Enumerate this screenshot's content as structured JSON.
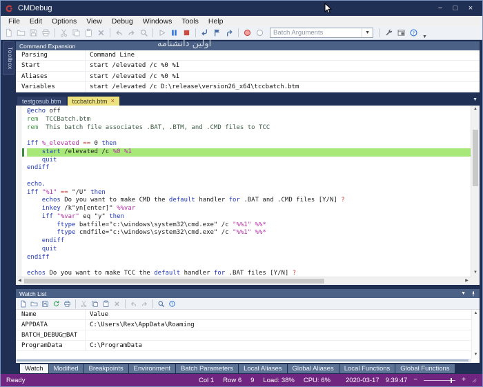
{
  "window": {
    "title": "CMDebug",
    "watermark": "اولین دانشنامه"
  },
  "titlebar": {
    "minimize": "−",
    "maximize": "□",
    "close": "×"
  },
  "menu": {
    "items": [
      "File",
      "Edit",
      "Options",
      "View",
      "Debug",
      "Windows",
      "Tools",
      "Help"
    ]
  },
  "toolbar": {
    "batch_arguments_placeholder": "Batch Arguments"
  },
  "toolbox": {
    "label": "Toolbox"
  },
  "command_expansion": {
    "title": "Command Expansion",
    "rows": [
      {
        "name": "Parsing",
        "value": "Command Line"
      },
      {
        "name": "Start",
        "value": "start /elevated /c %0 %1"
      },
      {
        "name": "Aliases",
        "value": "start /elevated /c %0 %1"
      },
      {
        "name": "Variables",
        "value": "start /elevated /c D:\\release\\version26_x64\\tccbatch.btm"
      }
    ]
  },
  "editor": {
    "tabs": [
      {
        "label": "testgosub.btm",
        "active": false
      },
      {
        "label": "tccbatch.btm",
        "active": true,
        "close": "×"
      }
    ],
    "lines": [
      {
        "s": [
          [
            "@echo",
            "k"
          ],
          [
            " off",
            "t"
          ]
        ]
      },
      {
        "s": [
          [
            "rem",
            "cg"
          ],
          [
            "  TCCBatch.btm",
            "ct"
          ]
        ]
      },
      {
        "s": [
          [
            "rem",
            "cg"
          ],
          [
            "  This batch file associates .BAT, .BTM, and .CMD files to TCC",
            "ct"
          ]
        ]
      },
      {
        "s": []
      },
      {
        "s": [
          [
            "iff",
            "k"
          ],
          [
            " ",
            "t"
          ],
          [
            "%_elevated",
            "v"
          ],
          [
            " ",
            "t"
          ],
          [
            "==",
            "o"
          ],
          [
            " 0 ",
            "t"
          ],
          [
            "then",
            "k"
          ]
        ]
      },
      {
        "hl": true,
        "s": [
          [
            "    ",
            "t"
          ],
          [
            "start",
            "k"
          ],
          [
            " /elevated /c ",
            "t"
          ],
          [
            "%0",
            "v"
          ],
          [
            " ",
            "t"
          ],
          [
            "%1",
            "v"
          ]
        ]
      },
      {
        "s": [
          [
            "    ",
            "t"
          ],
          [
            "quit",
            "k"
          ]
        ]
      },
      {
        "s": [
          [
            "endiff",
            "k"
          ]
        ]
      },
      {
        "s": []
      },
      {
        "s": [
          [
            "echo.",
            "k"
          ]
        ]
      },
      {
        "s": [
          [
            "iff",
            "k"
          ],
          [
            " ",
            "t"
          ],
          [
            "\"%1\"",
            "v"
          ],
          [
            " ",
            "t"
          ],
          [
            "==",
            "o"
          ],
          [
            " \"/U\" ",
            "t"
          ],
          [
            "then",
            "k"
          ]
        ]
      },
      {
        "s": [
          [
            "    ",
            "t"
          ],
          [
            "echos",
            "k"
          ],
          [
            " Do you want to make CMD the ",
            "t"
          ],
          [
            "default",
            "k"
          ],
          [
            " handler ",
            "t"
          ],
          [
            "for",
            "k"
          ],
          [
            " .BAT and .CMD files [Y/N] ",
            "t"
          ],
          [
            "?",
            "o"
          ]
        ]
      },
      {
        "s": [
          [
            "    ",
            "t"
          ],
          [
            "inkey",
            "k"
          ],
          [
            " /k\"yn[enter]\" ",
            "t"
          ],
          [
            "%%var",
            "v"
          ]
        ]
      },
      {
        "s": [
          [
            "    ",
            "t"
          ],
          [
            "iff",
            "k"
          ],
          [
            " ",
            "t"
          ],
          [
            "\"%var\"",
            "v"
          ],
          [
            " eq \"y\" ",
            "t"
          ],
          [
            "then",
            "k"
          ]
        ]
      },
      {
        "s": [
          [
            "        ",
            "t"
          ],
          [
            "ftype",
            "k"
          ],
          [
            " batfile=\"c:\\windows\\system32\\cmd.exe\" /c ",
            "t"
          ],
          [
            "\"%%1\"",
            "v"
          ],
          [
            " ",
            "t"
          ],
          [
            "%%*",
            "v"
          ]
        ]
      },
      {
        "s": [
          [
            "        ",
            "t"
          ],
          [
            "ftype",
            "k"
          ],
          [
            " cmdfile=\"c:\\windows\\system32\\cmd.exe\" /c ",
            "t"
          ],
          [
            "\"%%1\"",
            "v"
          ],
          [
            " ",
            "t"
          ],
          [
            "%%*",
            "v"
          ]
        ]
      },
      {
        "s": [
          [
            "    ",
            "t"
          ],
          [
            "endiff",
            "k"
          ]
        ]
      },
      {
        "s": [
          [
            "    ",
            "t"
          ],
          [
            "quit",
            "k"
          ]
        ]
      },
      {
        "s": [
          [
            "endiff",
            "k"
          ]
        ]
      },
      {
        "s": []
      },
      {
        "s": [
          [
            "echos",
            "k"
          ],
          [
            " Do you want to make TCC the ",
            "t"
          ],
          [
            "default",
            "k"
          ],
          [
            " handler ",
            "t"
          ],
          [
            "for",
            "k"
          ],
          [
            " .BAT files [Y/N] ",
            "t"
          ],
          [
            "?",
            "o"
          ]
        ]
      }
    ]
  },
  "watch": {
    "title": "Watch List",
    "columns": [
      "Name",
      "Value"
    ],
    "rows": [
      {
        "name": "APPDATA",
        "value": "C:\\Users\\Rex\\AppData\\Roaming"
      },
      {
        "name": "BATCH_DEBUG□BAT",
        "value": ""
      },
      {
        "name": "ProgramData",
        "value": "C:\\ProgramData"
      }
    ],
    "tabs": [
      "Watch",
      "Modified",
      "Breakpoints",
      "Environment",
      "Batch Parameters",
      "Local Aliases",
      "Global Aliases",
      "Local Functions",
      "Global Functions"
    ],
    "active_tab": "Watch"
  },
  "status": {
    "ready": "Ready",
    "col": "Col 1",
    "row": "Row 6",
    "count": "9",
    "load": "Load: 38%",
    "cpu": "CPU: 6%",
    "date": "2020-03-17",
    "time": "9:39:47"
  },
  "colors": {
    "panel_header": "#4c6186",
    "active_tab": "#ede27e",
    "highlight_line": "#a8e878",
    "statusbar": "#702581",
    "keyword": "#2038b8",
    "variable": "#b52fa8",
    "operator": "#c24038",
    "comment": "#3f9b41"
  }
}
